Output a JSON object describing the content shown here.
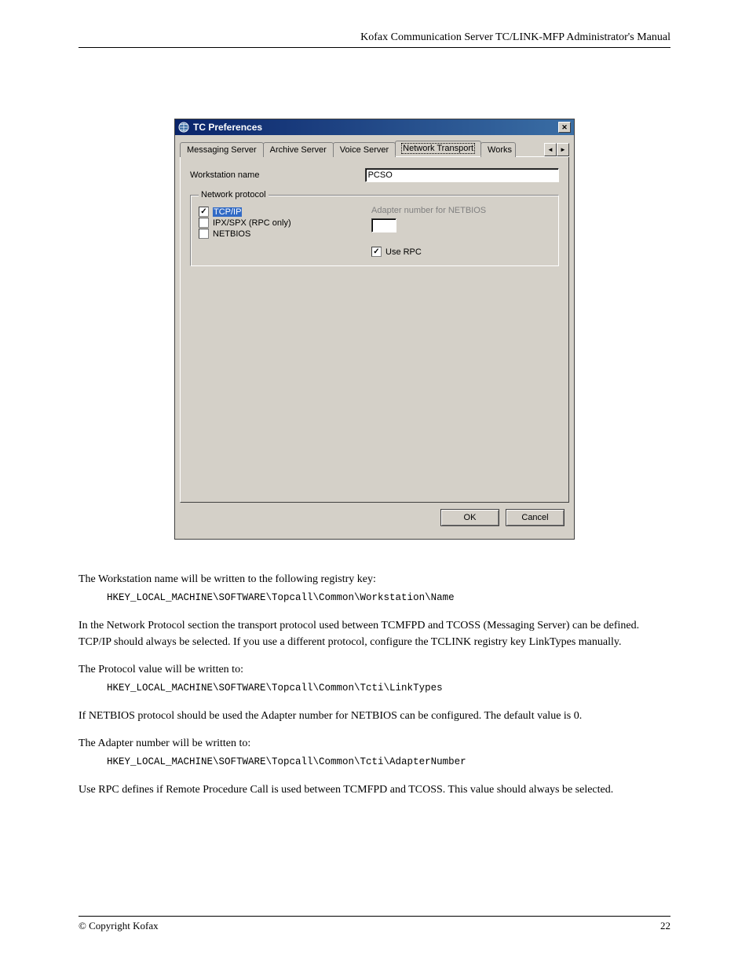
{
  "header": {
    "doc_title": "Kofax Communication Server TC/LINK-MFP Administrator's Manual"
  },
  "dialog": {
    "title": "TC Preferences",
    "tabs": [
      "Messaging Server",
      "Archive Server",
      "Voice Server",
      "Network Transport",
      "Works"
    ],
    "active_tab_index": 3,
    "workstation_label": "Workstation name",
    "workstation_value": "PCSO",
    "group_legend": "Network protocol",
    "protocols": {
      "tcpip": {
        "label": "TCP/IP",
        "checked": true
      },
      "ipxspx": {
        "label": "IPX/SPX (RPC only)",
        "checked": false
      },
      "netbios": {
        "label": "NETBIOS",
        "checked": false
      }
    },
    "adapter_label": "Adapter number for NETBIOS",
    "adapter_value": "",
    "use_rpc": {
      "label": "Use RPC",
      "checked": true
    },
    "buttons": {
      "ok": "OK",
      "cancel": "Cancel"
    }
  },
  "body": {
    "p1": "The Workstation name will be written to the following registry key:",
    "reg1": "HKEY_LOCAL_MACHINE\\SOFTWARE\\Topcall\\Common\\Workstation\\Name",
    "p2": "In the Network Protocol section the transport protocol used between TCMFPD and TCOSS (Messaging Server) can be defined. TCP/IP should always be selected. If you use a different protocol, configure the TCLINK registry key LinkTypes manually.",
    "p3": "The Protocol value will be written to:",
    "reg2": "HKEY_LOCAL_MACHINE\\SOFTWARE\\Topcall\\Common\\Tcti\\LinkTypes",
    "p4": "If NETBIOS protocol should be used the Adapter number for NETBIOS can be configured. The default value is 0.",
    "p5": "The Adapter number will be written to:",
    "reg3": "HKEY_LOCAL_MACHINE\\SOFTWARE\\Topcall\\Common\\Tcti\\AdapterNumber",
    "p6": "Use RPC defines if Remote Procedure Call is used between TCMFPD and TCOSS. This value should always be selected."
  },
  "footer": {
    "left": "© Copyright Kofax",
    "right": "22"
  }
}
